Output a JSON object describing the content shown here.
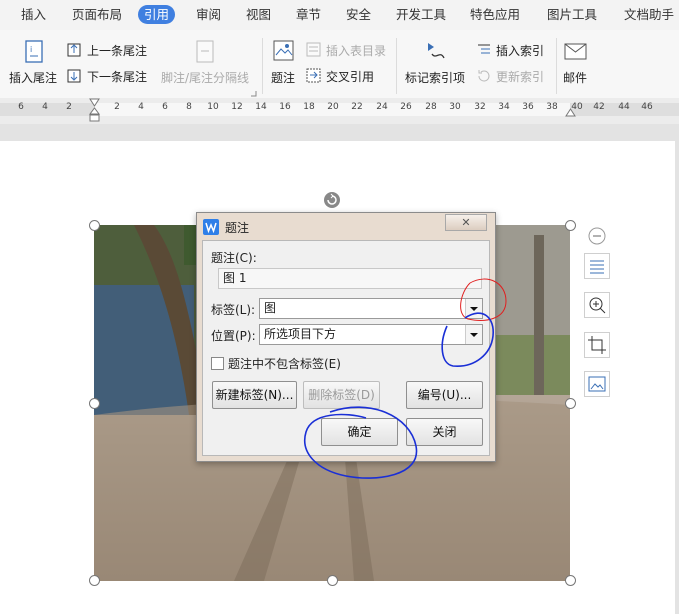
{
  "menu": {
    "items": [
      "插入",
      "页面布局",
      "引用",
      "审阅",
      "视图",
      "章节",
      "安全",
      "开发工具",
      "特色应用",
      "图片工具",
      "文档助手"
    ],
    "active": "引用"
  },
  "ribbon": {
    "insert_endnote": "插入尾注",
    "prev_endnote": "上一条尾注",
    "next_endnote": "下一条尾注",
    "footnote_separator": "脚注/尾注分隔线",
    "caption": "题注",
    "insert_table_of_figures": "插入表目录",
    "cross_reference": "交叉引用",
    "mark_index_entry": "标记索引项",
    "insert_index": "插入索引",
    "update_index": "更新索引",
    "mail": "邮件"
  },
  "ruler": {
    "ticks": [
      "6",
      "4",
      "2",
      "2",
      "4",
      "6",
      "8",
      "10",
      "12",
      "14",
      "16",
      "18",
      "20",
      "22",
      "24",
      "26",
      "28",
      "30",
      "32",
      "34",
      "36",
      "38",
      "40",
      "42",
      "44",
      "46"
    ]
  },
  "dialog": {
    "title": "题注",
    "close_label": "✕",
    "caption_label": "题注(C):",
    "caption_value": "图 1",
    "tag_label": "标签(L):",
    "tag_value": "图",
    "position_label": "位置(P):",
    "position_value": "所选项目下方",
    "exclude_label_checkbox": "题注中不包含标签(E)",
    "exclude_label_checked": false,
    "new_label_button": "新建标签(N)...",
    "delete_label_button": "删除标签(D)",
    "numbering_button": "编号(U)...",
    "ok_button": "确定",
    "close_button": "关闭"
  },
  "colors": {
    "accent": "#3f7fe0",
    "annotation_blue": "#1a2fd6",
    "annotation_red": "#e02020"
  }
}
